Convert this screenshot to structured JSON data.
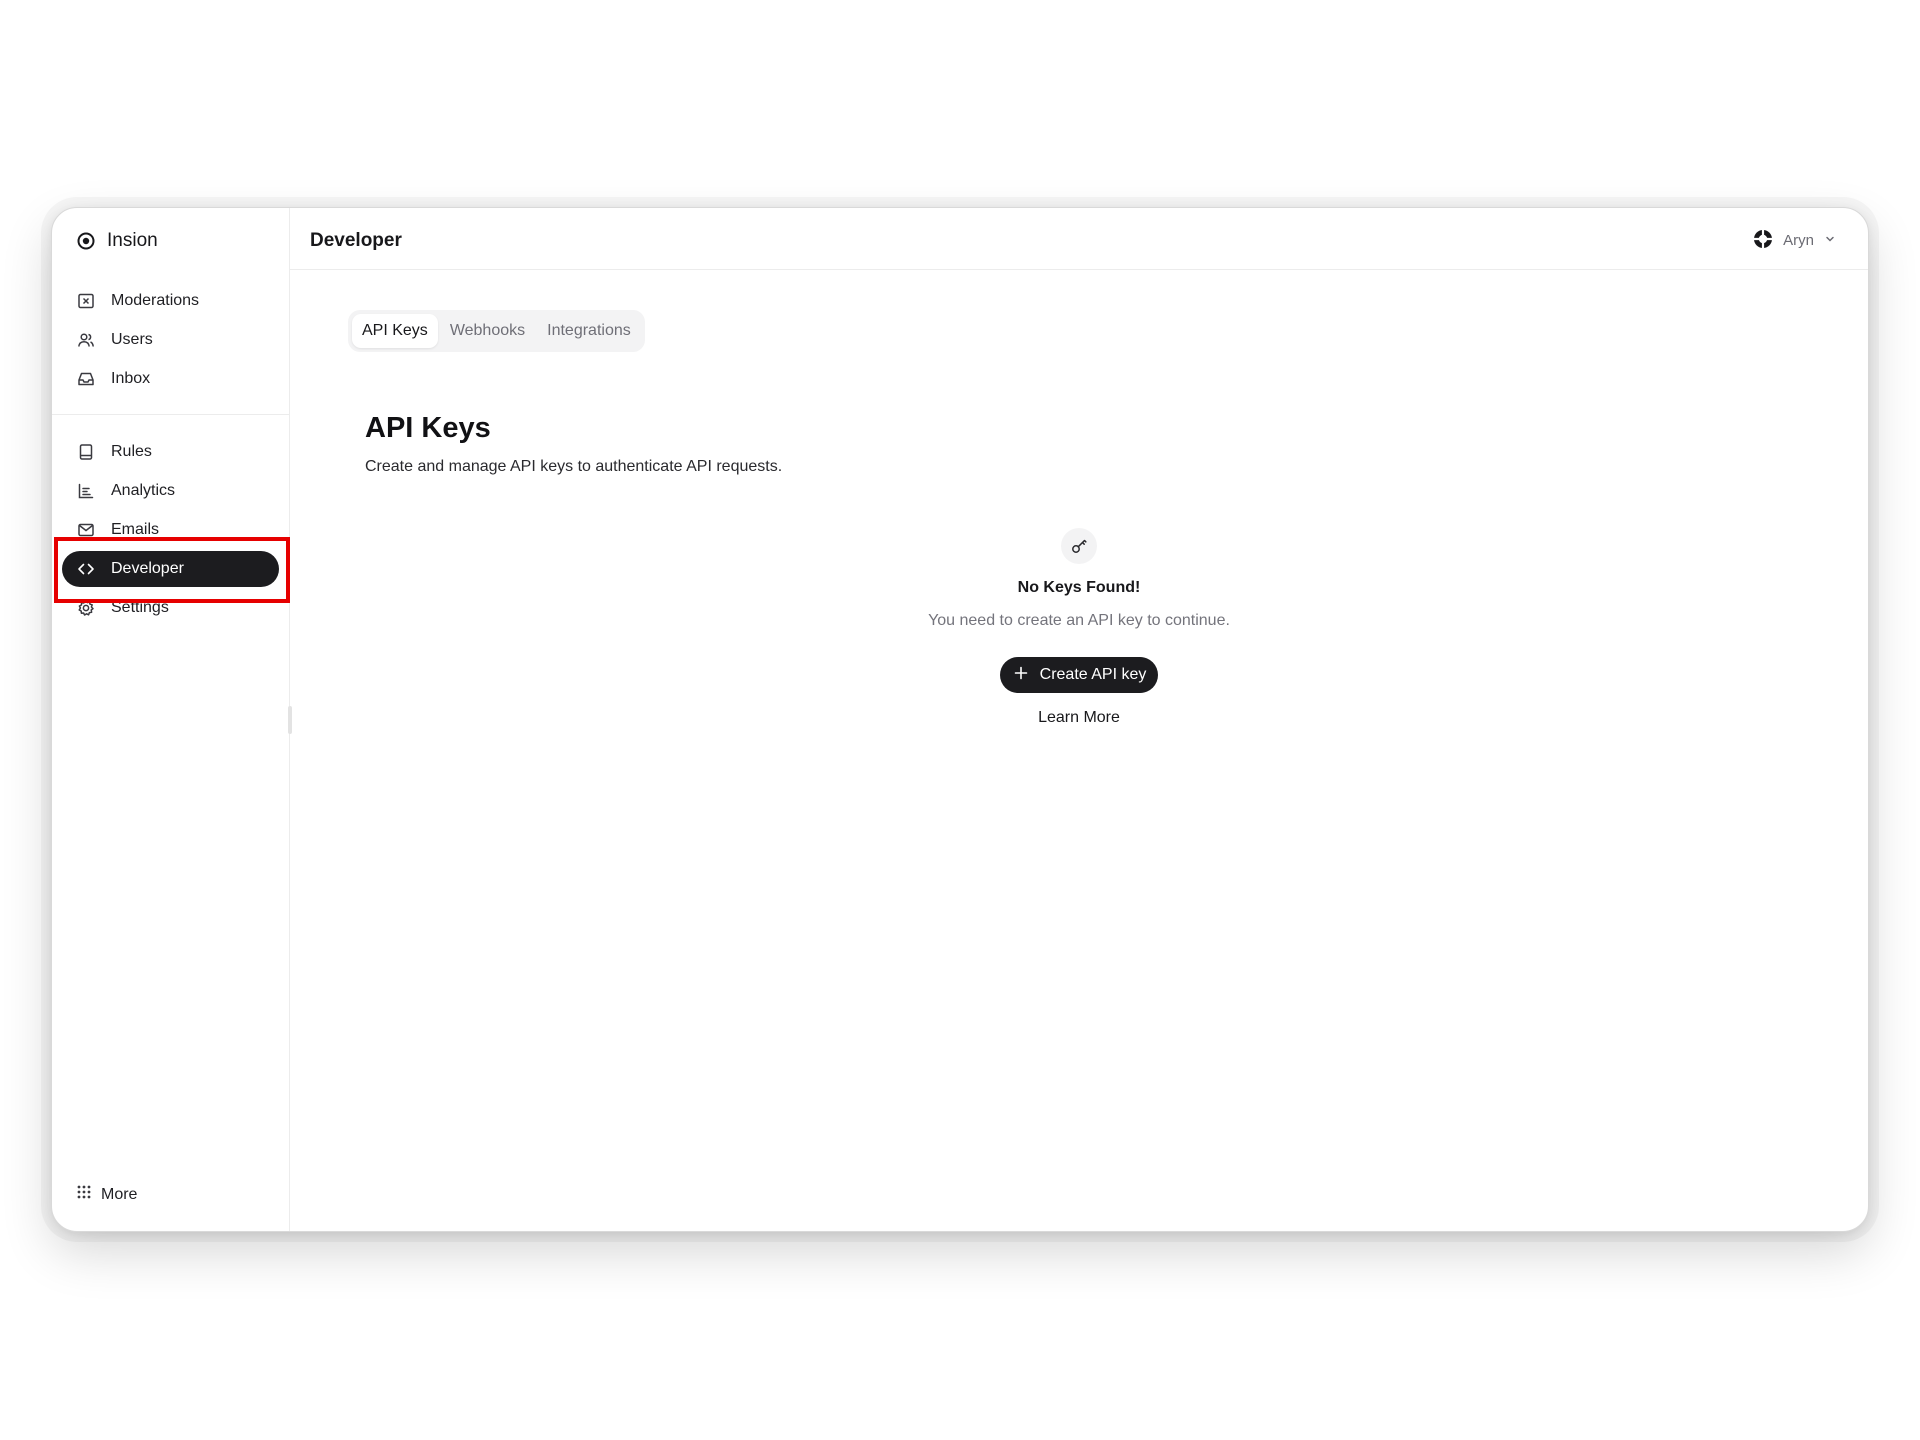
{
  "app": {
    "name": "Insion"
  },
  "sidebar": {
    "groups": [
      [
        {
          "label": "Moderations",
          "icon": "square-x-icon"
        },
        {
          "label": "Users",
          "icon": "users-icon"
        },
        {
          "label": "Inbox",
          "icon": "inbox-icon"
        }
      ],
      [
        {
          "label": "Rules",
          "icon": "book-icon"
        },
        {
          "label": "Analytics",
          "icon": "bar-chart-icon"
        },
        {
          "label": "Emails",
          "icon": "mail-icon"
        },
        {
          "label": "Developer",
          "icon": "code-icon",
          "active": true
        },
        {
          "label": "Settings",
          "icon": "gear-icon"
        }
      ]
    ],
    "more_label": "More"
  },
  "header": {
    "title": "Developer",
    "user_name": "Aryn"
  },
  "tabs": [
    {
      "label": "API Keys",
      "active": true
    },
    {
      "label": "Webhooks"
    },
    {
      "label": "Integrations"
    }
  ],
  "page": {
    "heading": "API Keys",
    "subheading": "Create and manage API keys to authenticate API requests."
  },
  "empty_state": {
    "title": "No Keys Found!",
    "description": "You need to create an API key to continue.",
    "create_label": "Create API key",
    "learn_more_label": "Learn More"
  },
  "colors": {
    "active_bg": "#1c1c1f",
    "highlight": "#e60000"
  }
}
